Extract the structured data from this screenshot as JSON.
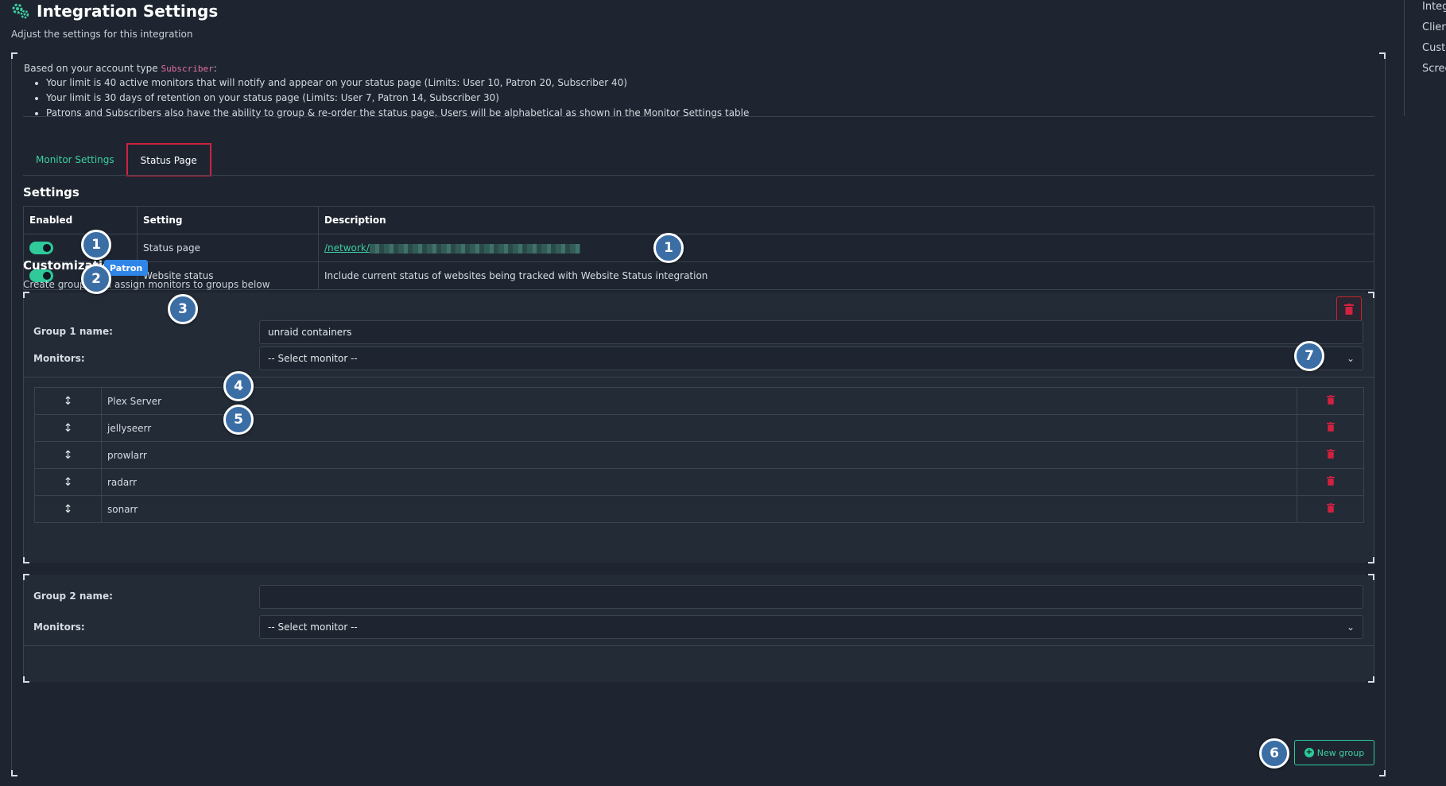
{
  "header": {
    "title": "Integration Settings",
    "subtitle": "Adjust the settings for this integration"
  },
  "right_nav": {
    "items": [
      "Integ",
      "Clien",
      "Custo",
      "Scree"
    ]
  },
  "info": {
    "intro": "Based on your account type",
    "account_type": "Subscriber",
    "colon": ":",
    "bullets": [
      "Your limit is 40 active monitors that will notify and appear on your status page (Limits: User 10, Patron 20, Subscriber 40)",
      "Your limit is 30 days of retention on your status page (Limits: User 7, Patron 14, Subscriber 30)",
      "Patrons and Subscribers also have the ability to group & re-order the status page, Users will be alphabetical as shown in the Monitor Settings table"
    ]
  },
  "tabs": [
    {
      "label": "Monitor Settings",
      "active": false
    },
    {
      "label": "Status Page",
      "active": true
    }
  ],
  "settings": {
    "heading": "Settings",
    "columns": [
      "Enabled",
      "Setting",
      "Description"
    ],
    "rows": [
      {
        "enabled": true,
        "setting": "Status page",
        "description": "/network/"
      },
      {
        "enabled": true,
        "setting": "Website status",
        "description": "Include current status of websites being tracked with Website Status integration"
      }
    ]
  },
  "customization": {
    "heading": "Customization",
    "badge": "Patron",
    "subtitle": "Create groups and assign monitors to groups below"
  },
  "groups": [
    {
      "name_label": "Group 1 name:",
      "name_value": "unraid containers",
      "monitors_label": "Monitors:",
      "select_placeholder": "-- Select monitor --",
      "monitors": [
        "Plex Server",
        "jellyseerr",
        "prowlarr",
        "radarr",
        "sonarr"
      ]
    },
    {
      "name_label": "Group 2 name:",
      "name_value": "",
      "monitors_label": "Monitors:",
      "select_placeholder": "-- Select monitor --",
      "monitors": []
    }
  ],
  "new_group_label": "New group",
  "callouts": [
    "1",
    "2",
    "3",
    "4",
    "5",
    "6",
    "7",
    "1"
  ],
  "colors": {
    "background": "#1e2530",
    "accent": "#2fc99a",
    "danger": "#c8252b",
    "badge": "#2f86e8",
    "callout": "#3c6ea6",
    "tab_highlight": "#d0213f"
  }
}
